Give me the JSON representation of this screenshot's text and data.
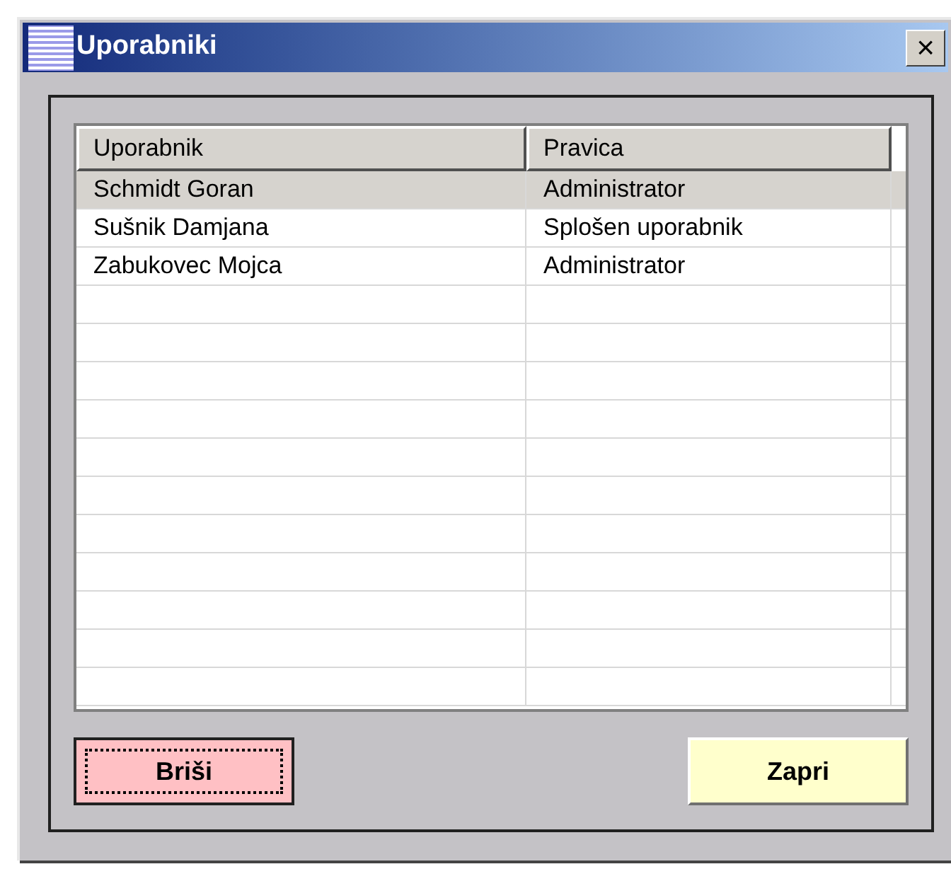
{
  "window": {
    "title": "Uporabniki",
    "close": "×"
  },
  "table": {
    "columns": [
      "Uporabnik",
      "Pravica"
    ],
    "rows": [
      {
        "cells": [
          "Schmidt Goran",
          "Administrator"
        ],
        "selected": true
      },
      {
        "cells": [
          "Sušnik Damjana",
          "Splošen uporabnik"
        ],
        "selected": false
      },
      {
        "cells": [
          "Zabukovec Mojca",
          "Administrator"
        ],
        "selected": false
      }
    ]
  },
  "buttons": [
    {
      "label": "Briši",
      "kind": "delete",
      "focused": true
    },
    {
      "label": "Zapri",
      "kind": "close",
      "focused": false
    }
  ]
}
